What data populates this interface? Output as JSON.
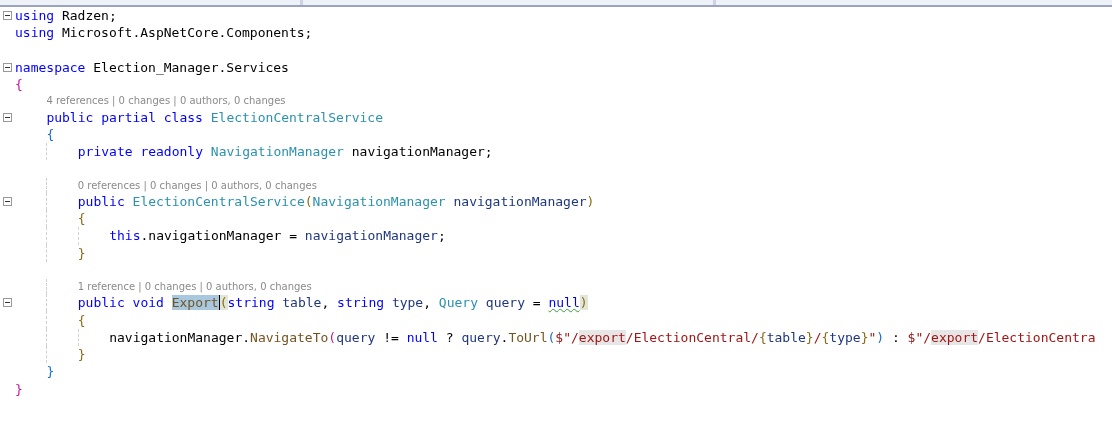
{
  "navigation_bar": {
    "dropdowns": [
      {
        "kind": "project"
      },
      {
        "kind": "type"
      },
      {
        "kind": "member"
      }
    ]
  },
  "lines": [
    {
      "kind": "code",
      "foldable": true,
      "tokens": [
        {
          "kind": "kw",
          "s": "using"
        },
        {
          "kind": "plain",
          "s": " Radzen;"
        }
      ]
    },
    {
      "kind": "code",
      "foldable": false,
      "tokens": [
        {
          "kind": "kw",
          "s": "using"
        },
        {
          "kind": "plain",
          "s": " Microsoft.AspNetCore.Components;"
        }
      ]
    },
    {
      "kind": "blank"
    },
    {
      "kind": "code",
      "foldable": true,
      "tokens": [
        {
          "kind": "kw",
          "s": "namespace"
        },
        {
          "kind": "plain",
          "s": " Election_Manager.Services"
        }
      ]
    },
    {
      "kind": "code",
      "foldable": false,
      "tokens": [
        {
          "kind": "brace1",
          "s": "{"
        }
      ],
      "children": [
        {
          "kind": "lens",
          "text": "4 references | 0 changes | 0 authors, 0 changes"
        },
        {
          "kind": "code",
          "foldable": true,
          "tokens": [
            {
              "kind": "kw",
              "s": "public partial class "
            },
            {
              "kind": "type",
              "s": "ElectionCentralService"
            }
          ]
        },
        {
          "kind": "code",
          "foldable": false,
          "tokens": [
            {
              "kind": "brace2",
              "s": "{"
            }
          ],
          "children": [
            {
              "kind": "code",
              "foldable": false,
              "tokens": [
                {
                  "kind": "kw",
                  "s": "private readonly "
                },
                {
                  "kind": "type",
                  "s": "NavigationManager"
                },
                {
                  "kind": "plain",
                  "s": " navigationManager;"
                }
              ]
            },
            {
              "kind": "blank"
            },
            {
              "kind": "lens",
              "text": "0 references | 0 changes | 0 authors, 0 changes"
            },
            {
              "kind": "code",
              "foldable": true,
              "tokens": [
                {
                  "kind": "kw",
                  "s": "public "
                },
                {
                  "kind": "type",
                  "s": "ElectionCentralService"
                },
                {
                  "kind": "brace3",
                  "s": "("
                },
                {
                  "kind": "type",
                  "s": "NavigationManager"
                },
                {
                  "kind": "local",
                  "s": " navigationManager"
                },
                {
                  "kind": "brace3",
                  "s": ")"
                }
              ]
            },
            {
              "kind": "code",
              "foldable": false,
              "tokens": [
                {
                  "kind": "brace3",
                  "s": "{"
                }
              ],
              "children": [
                {
                  "kind": "code",
                  "foldable": false,
                  "tokens": [
                    {
                      "kind": "kw",
                      "s": "this"
                    },
                    {
                      "kind": "plain",
                      "s": ".navigationManager = "
                    },
                    {
                      "kind": "local",
                      "s": "navigationManager"
                    },
                    {
                      "kind": "plain",
                      "s": ";"
                    }
                  ]
                }
              ]
            },
            {
              "kind": "code",
              "foldable": false,
              "tokens": [
                {
                  "kind": "brace3",
                  "s": "}"
                }
              ]
            },
            {
              "kind": "blank"
            },
            {
              "kind": "lens",
              "text": "1 reference | 0 changes | 0 authors, 0 changes"
            },
            {
              "kind": "code",
              "foldable": true,
              "tokens": [
                {
                  "kind": "kw",
                  "s": "public void "
                },
                {
                  "kind": "method",
                  "s": "Export",
                  "selected": true
                },
                {
                  "kind": "brace3",
                  "s": "(",
                  "bracket_match": true
                },
                {
                  "kind": "kw",
                  "s": "string"
                },
                {
                  "kind": "local",
                  "s": " table"
                },
                {
                  "kind": "plain",
                  "s": ", "
                },
                {
                  "kind": "kw",
                  "s": "string"
                },
                {
                  "kind": "local",
                  "s": " type"
                },
                {
                  "kind": "plain",
                  "s": ", "
                },
                {
                  "kind": "type",
                  "s": "Query"
                },
                {
                  "kind": "local",
                  "s": " query"
                },
                {
                  "kind": "plain",
                  "s": " = "
                },
                {
                  "kind": "kw",
                  "s": "null",
                  "squiggle": true
                },
                {
                  "kind": "brace3",
                  "s": ")",
                  "bracket_match": true
                }
              ]
            },
            {
              "kind": "code",
              "foldable": false,
              "tokens": [
                {
                  "kind": "brace3",
                  "s": "{"
                }
              ],
              "children": [
                {
                  "kind": "code",
                  "foldable": false,
                  "tokens": [
                    {
                      "kind": "plain",
                      "s": "navigationManager."
                    },
                    {
                      "kind": "method",
                      "s": "NavigateTo"
                    },
                    {
                      "kind": "brace1",
                      "s": "("
                    },
                    {
                      "kind": "local",
                      "s": "query"
                    },
                    {
                      "kind": "plain",
                      "s": " != "
                    },
                    {
                      "kind": "kw",
                      "s": "null"
                    },
                    {
                      "kind": "plain",
                      "s": " ? "
                    },
                    {
                      "kind": "local",
                      "s": "query"
                    },
                    {
                      "kind": "plain",
                      "s": "."
                    },
                    {
                      "kind": "method",
                      "s": "ToUrl"
                    },
                    {
                      "kind": "brace2",
                      "s": "("
                    },
                    {
                      "kind": "string",
                      "s": "$\"/"
                    },
                    {
                      "kind": "string",
                      "s": "export",
                      "reference_highlight": true
                    },
                    {
                      "kind": "string",
                      "s": "/ElectionCentral/"
                    },
                    {
                      "kind": "brace3",
                      "s": "{"
                    },
                    {
                      "kind": "local",
                      "s": "table"
                    },
                    {
                      "kind": "brace3",
                      "s": "}"
                    },
                    {
                      "kind": "string",
                      "s": "/"
                    },
                    {
                      "kind": "brace3",
                      "s": "{"
                    },
                    {
                      "kind": "local",
                      "s": "type"
                    },
                    {
                      "kind": "brace3",
                      "s": "}"
                    },
                    {
                      "kind": "string",
                      "s": "\""
                    },
                    {
                      "kind": "brace2",
                      "s": ")"
                    },
                    {
                      "kind": "plain",
                      "s": " : "
                    },
                    {
                      "kind": "string",
                      "s": "$\"/"
                    },
                    {
                      "kind": "string",
                      "s": "export",
                      "reference_highlight": true
                    },
                    {
                      "kind": "string",
                      "s": "/ElectionCentra"
                    }
                  ]
                }
              ]
            },
            {
              "kind": "code",
              "foldable": false,
              "tokens": [
                {
                  "kind": "brace3",
                  "s": "}"
                }
              ]
            }
          ]
        },
        {
          "kind": "code",
          "foldable": false,
          "tokens": [
            {
              "kind": "brace2",
              "s": "}"
            }
          ]
        }
      ]
    },
    {
      "kind": "code",
      "foldable": false,
      "tokens": [
        {
          "kind": "brace1",
          "s": "}"
        }
      ]
    }
  ]
}
